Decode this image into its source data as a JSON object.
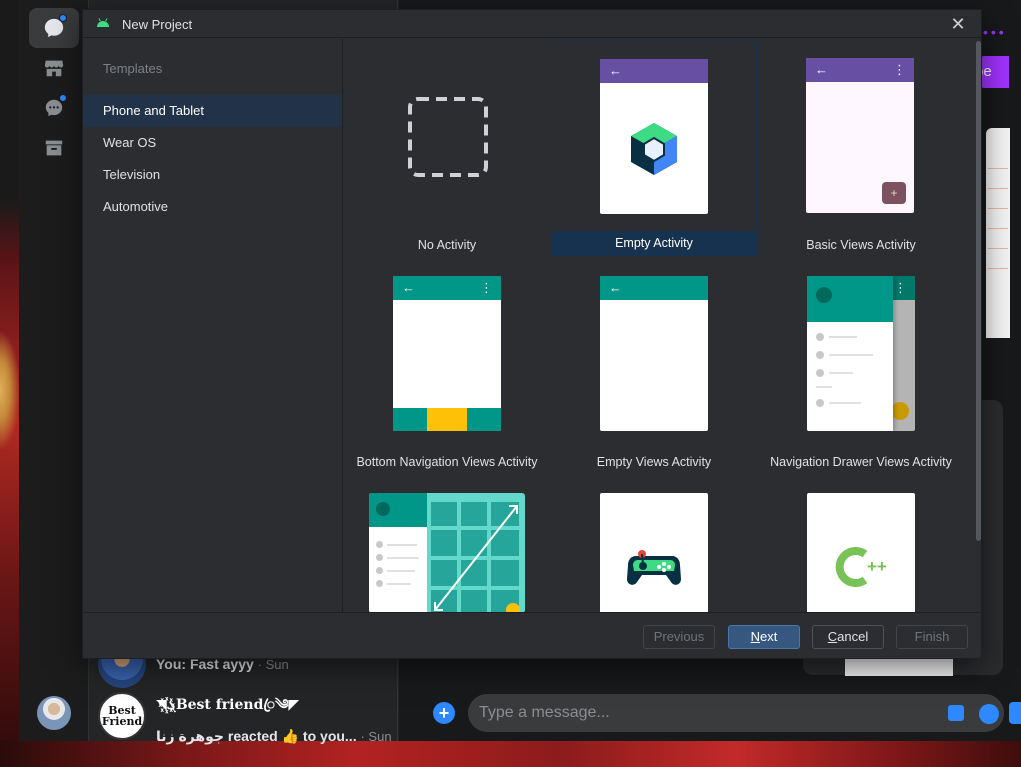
{
  "background": {
    "chat_list": {
      "row1": {
        "message": "You: Fast ayyy",
        "time": "· Sun"
      },
      "row2": {
        "name": "◥ܓ꙰Best friendꦿ༄◤",
        "message": "جوهرة زنا reacted 👍 to you...",
        "time": "· Sun"
      }
    },
    "pane": {
      "subscribe_fragment": "be",
      "composer_placeholder": "Type a message..."
    },
    "accent": "#2e89ff"
  },
  "dialog": {
    "title": "New Project",
    "sidebar": {
      "header": "Templates",
      "items": [
        {
          "label": "Phone and Tablet",
          "selected": true
        },
        {
          "label": "Wear OS",
          "selected": false
        },
        {
          "label": "Television",
          "selected": false
        },
        {
          "label": "Automotive",
          "selected": false
        }
      ]
    },
    "templates": [
      {
        "label": "No Activity"
      },
      {
        "label": "Empty Activity",
        "selected": true
      },
      {
        "label": "Basic Views Activity"
      },
      {
        "label": "Bottom Navigation Views Activity"
      },
      {
        "label": "Empty Views Activity"
      },
      {
        "label": "Navigation Drawer Views Activity"
      }
    ],
    "buttons": {
      "previous": "Previous",
      "next_u": "N",
      "next_rest": "ext",
      "cancel_u": "C",
      "cancel_rest": "ancel",
      "finish": "Finish"
    },
    "colors": {
      "purple_appbar": "#6750a4",
      "teal_appbar": "#009688",
      "selection": "#17324f",
      "primary_button": "#365880"
    }
  }
}
